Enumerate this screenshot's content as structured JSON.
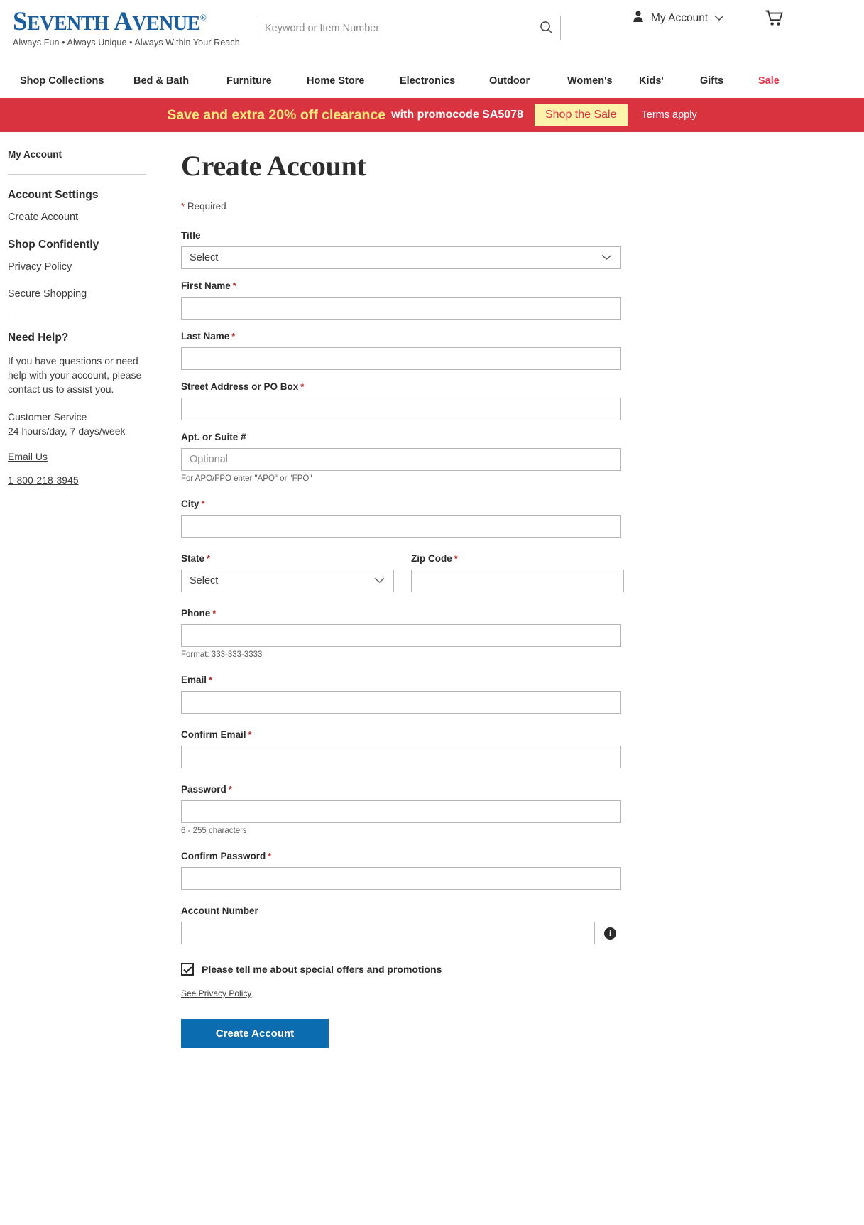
{
  "brand": {
    "name_part1": "S",
    "name_rest1": "EVENTH",
    "name_part2": "A",
    "name_rest2": "VENUE",
    "registered": "®",
    "tagline": "Always Fun • Always Unique • Always Within Your Reach",
    "logo_color": "#1b5e9e"
  },
  "search": {
    "placeholder": "Keyword or Item Number",
    "value": "",
    "icon": "search-icon"
  },
  "header": {
    "account_label": "My Account",
    "account_icon": "user-icon",
    "chevron_icon": "chevron-down-icon",
    "cart_icon": "shopping-cart-icon"
  },
  "nav": {
    "items": [
      {
        "label": "Shop Collections",
        "sale": false
      },
      {
        "label": "Bed & Bath",
        "sale": false
      },
      {
        "label": "Furniture",
        "sale": false
      },
      {
        "label": "Home Store",
        "sale": false
      },
      {
        "label": "Electronics",
        "sale": false
      },
      {
        "label": "Outdoor",
        "sale": false
      },
      {
        "label": "Women's",
        "sale": false
      },
      {
        "label": "Kids'",
        "sale": false
      },
      {
        "label": "Gifts",
        "sale": false
      },
      {
        "label": "Sale",
        "sale": true
      }
    ]
  },
  "promo": {
    "headline": "Save and extra 20% off clearance",
    "subline": "with promocode SA5078",
    "button_label": "Shop the Sale",
    "terms_label": "Terms apply",
    "bg_color": "#d93340",
    "headline_color": "#ffe97f",
    "button_bg": "#fdf3ab"
  },
  "sidebar": {
    "top_label": "My Account",
    "sections": [
      {
        "heading": "Account Settings",
        "links": [
          "Create Account"
        ]
      },
      {
        "heading": "Shop Confidently",
        "links": [
          "Privacy Policy",
          "Secure Shopping"
        ]
      }
    ],
    "help": {
      "heading": "Need Help?",
      "paragraph": "If you have questions or need help with your account, please contact us to assist you.",
      "cs_line1": "Customer Service",
      "cs_line2": "24 hours/day, 7 days/week",
      "email_link": "Email Us",
      "phone_link": "1-800-218-3945"
    }
  },
  "main": {
    "title": "Create Account",
    "required_note": "Required",
    "required_star": "*",
    "fields": {
      "title": {
        "label": "Title",
        "required": false,
        "value": "Select",
        "type": "select"
      },
      "first_name": {
        "label": "First Name",
        "required": true,
        "value": "",
        "type": "text"
      },
      "last_name": {
        "label": "Last Name",
        "required": true,
        "value": "",
        "type": "text"
      },
      "street": {
        "label": "Street Address or PO Box",
        "required": true,
        "value": "",
        "type": "text"
      },
      "apt": {
        "label": "Apt. or Suite #",
        "required": false,
        "value": "",
        "placeholder": "Optional",
        "type": "text",
        "hint": "For APO/FPO enter \"APO\" or \"FPO\""
      },
      "city": {
        "label": "City",
        "required": true,
        "value": "",
        "type": "text"
      },
      "state": {
        "label": "State",
        "required": true,
        "value": "Select",
        "type": "select"
      },
      "zip": {
        "label": "Zip Code",
        "required": true,
        "value": "",
        "type": "text"
      },
      "phone": {
        "label": "Phone",
        "required": true,
        "value": "",
        "type": "text",
        "hint": "Format: 333-333-3333"
      },
      "email": {
        "label": "Email",
        "required": true,
        "value": "",
        "type": "text"
      },
      "confirm_email": {
        "label": "Confirm Email",
        "required": true,
        "value": "",
        "type": "text"
      },
      "password": {
        "label": "Password",
        "required": true,
        "value": "",
        "type": "password",
        "hint": "6 - 255 characters"
      },
      "confirm_password": {
        "label": "Confirm Password",
        "required": true,
        "value": "",
        "type": "password"
      },
      "account_number": {
        "label": "Account Number",
        "required": false,
        "value": "",
        "type": "text",
        "info_icon": "info-icon"
      }
    },
    "offers_checkbox": {
      "label": "Please tell me about special offers and promotions",
      "checked": true
    },
    "privacy_link": "See Privacy Policy",
    "submit_label": "Create Account",
    "submit_color": "#0b6cb0"
  }
}
